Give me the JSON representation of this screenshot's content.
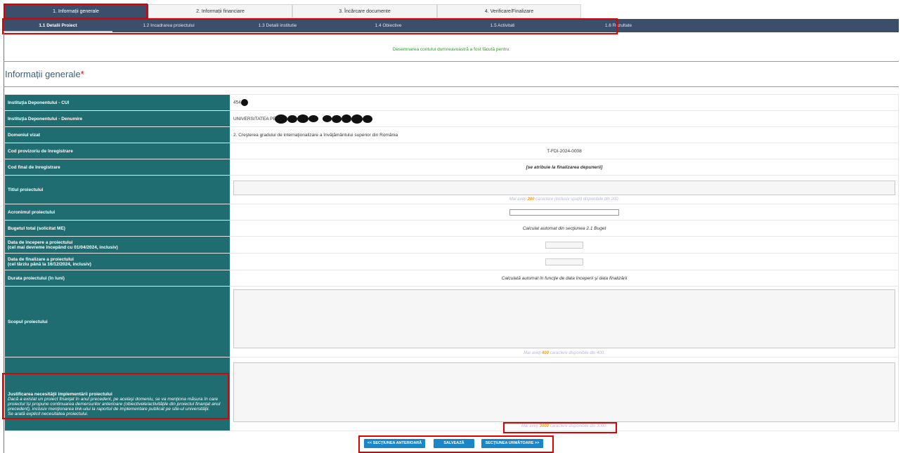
{
  "steps": [
    {
      "label": "1. Informații generale",
      "active": true
    },
    {
      "label": "2. Informații financiare",
      "active": false
    },
    {
      "label": "3. Încărcare documente",
      "active": false
    },
    {
      "label": "4. Verificare/Finalizare",
      "active": false
    }
  ],
  "subtabs": [
    {
      "label": "1.1 Detalii Proiect",
      "active": true
    },
    {
      "label": "1.2 Incadrarea proiectului",
      "active": false
    },
    {
      "label": "1.3 Detalii institutie",
      "active": false
    },
    {
      "label": "1.4 Obiective",
      "active": false
    },
    {
      "label": "1.5 Activitati",
      "active": false
    },
    {
      "label": "1.6 Rezultate",
      "active": false
    }
  ],
  "notice": "Desemnarea contului dumneavoastră a fost făcută pentru:",
  "section": {
    "title": "Informații generale",
    "required_mark": "*"
  },
  "fields": {
    "cui": {
      "label": "Instituţia Deponentului - CUI",
      "value": "454"
    },
    "denumire": {
      "label": "Instituţia Deponentului - Denumire",
      "value": "UNIVERSITATEA PE"
    },
    "domeniu": {
      "label": "Domeniul vizat",
      "value": "2. Creşterea gradului de internaţionalizare a învăţământului superior din România"
    },
    "cod_provizoriu": {
      "label": "Cod provizoriu de înregistrare",
      "value": "T-FDI-2024-0008"
    },
    "cod_final": {
      "label": "Cod final de înregistrare",
      "value": "[se atribuie la finalizarea depunerii]"
    },
    "titlu": {
      "label": "Titlul proiectului",
      "counter_pre": "Mai aveţi ",
      "counter_num": "200",
      "counter_post": " caractere (inclusiv spaţii) disponibile din 200."
    },
    "acronim": {
      "label": "Acronimul proiectului",
      "value": ""
    },
    "buget": {
      "label": "Bugetul total (solicitat ME)",
      "value": "Calculat automat din secţiunea 2.1 Buget"
    },
    "data_inceput": {
      "label": "Data de începere a proiectului",
      "sub": "(cel mai devreme începând cu 01/04/2024, inclusiv)"
    },
    "data_final": {
      "label": "Data de finalizare a proiectului",
      "sub": "(cel târziu până la 16/12/2024, inclusiv)"
    },
    "durata": {
      "label": "Durata proiectului (în luni)",
      "value": "Calculată automat în funcţie de data începerii şi data finalizării"
    },
    "scop": {
      "label": "Scopul proiectului",
      "counter_pre": "Mai aveţi ",
      "counter_num": "400",
      "counter_post": " caractere disponibile din 400."
    },
    "justificare": {
      "label": "Justificarea necesităţii implementării proiectului",
      "sub": "Dacă a existat un proiect finanţat în anul precedent, pe acelaşi domeniu, se va menţiona măsura în care proiectul își propune continuarea demersurilor anterioare (obiectivele/activităţile din proiectul finanţat anul precedent), inclusiv menţionarea link-ului la raportul de implementare publicat pe site-ul universităţii.",
      "sub2": "Se arată explicit necesitatea proiectului.",
      "counter_pre": "Mai aveţi ",
      "counter_num": "3000",
      "counter_post": " caractere disponibile din 3000."
    }
  },
  "buttons": {
    "prev": "<< SECŢIUNEA ANTERIOARĂ",
    "save": "SALVEAZĂ",
    "next": "SECŢIUNEA URMĂTOARE >>"
  }
}
